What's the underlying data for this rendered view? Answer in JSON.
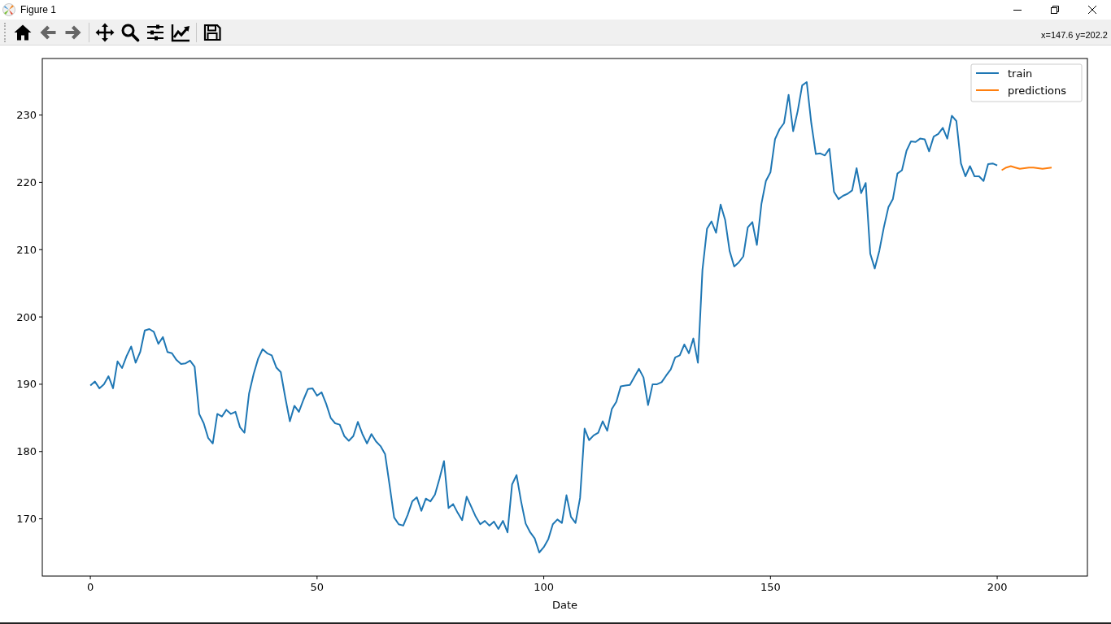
{
  "window": {
    "title": "Figure 1"
  },
  "toolbar": {
    "groups": [
      [
        {
          "kind": "home"
        },
        {
          "kind": "back"
        },
        {
          "kind": "forward"
        }
      ],
      [
        {
          "kind": "pan"
        },
        {
          "kind": "zoom"
        },
        {
          "kind": "configure"
        },
        {
          "kind": "edit"
        }
      ],
      [
        {
          "kind": "save"
        }
      ]
    ],
    "coordinates": "x=147.6 y=202.2"
  },
  "figure": {
    "chart_data": {
      "type": "line",
      "xlabel": "Date",
      "xlim": [
        -10.6,
        219.9
      ],
      "ylim": [
        161.5,
        238.4
      ],
      "xticks": [
        0,
        50,
        100,
        150,
        200
      ],
      "yticks": [
        170,
        180,
        190,
        200,
        210,
        220,
        230
      ],
      "x": [
        0,
        1,
        2,
        3,
        4,
        5,
        6,
        7,
        8,
        9,
        10,
        11,
        12,
        13,
        14,
        15,
        16,
        17,
        18,
        19,
        20,
        21,
        22,
        23,
        24,
        25,
        26,
        27,
        28,
        29,
        30,
        31,
        32,
        33,
        34,
        35,
        36,
        37,
        38,
        39,
        40,
        41,
        42,
        43,
        44,
        45,
        46,
        47,
        48,
        49,
        50,
        51,
        52,
        53,
        54,
        55,
        56,
        57,
        58,
        59,
        60,
        61,
        62,
        63,
        64,
        65,
        66,
        67,
        68,
        69,
        70,
        71,
        72,
        73,
        74,
        75,
        76,
        77,
        78,
        79,
        80,
        81,
        82,
        83,
        84,
        85,
        86,
        87,
        88,
        89,
        90,
        91,
        92,
        93,
        94,
        95,
        96,
        97,
        98,
        99,
        100,
        101,
        102,
        103,
        104,
        105,
        106,
        107,
        108,
        109,
        110,
        111,
        112,
        113,
        114,
        115,
        116,
        117,
        118,
        119,
        120,
        121,
        122,
        123,
        124,
        125,
        126,
        127,
        128,
        129,
        130,
        131,
        132,
        133,
        134,
        135,
        136,
        137,
        138,
        139,
        140,
        141,
        142,
        143,
        144,
        145,
        146,
        147,
        148,
        149,
        150,
        151,
        152,
        153,
        154,
        155,
        156,
        157,
        158,
        159,
        160,
        161,
        162,
        163,
        164,
        165,
        166,
        167,
        168,
        169,
        170,
        171,
        172,
        173,
        174,
        175,
        176,
        177,
        178,
        179,
        180,
        181,
        182,
        183,
        184,
        185,
        186,
        187,
        188,
        189,
        190,
        191,
        192,
        193,
        194,
        195,
        196,
        197,
        198,
        199,
        200,
        201,
        202,
        203,
        204,
        205,
        206,
        207,
        208,
        209,
        210,
        211,
        212
      ],
      "legend": true,
      "series": [
        {
          "name": "train",
          "color": "#1f77b4",
          "values": [
            189.8,
            190.4,
            189.4,
            190,
            191.2,
            189.4,
            193.4,
            192.4,
            194.2,
            195.6,
            193.2,
            194.8,
            198,
            198.2,
            197.8,
            196,
            197,
            194.8,
            194.6,
            193.6,
            193,
            193.1,
            193.5,
            192.6,
            185.6,
            184.2,
            182,
            181.2,
            185.6,
            185.2,
            186.2,
            185.6,
            185.9,
            183.6,
            182.8,
            188.6,
            191.5,
            193.8,
            195.2,
            194.6,
            194.3,
            192.5,
            191.8,
            188,
            184.5,
            186.8,
            185.9,
            187.7,
            189.3,
            189.4,
            188.3,
            188.8,
            187.1,
            185,
            184.2,
            184,
            182.3,
            181.6,
            182.3,
            184.4,
            182.6,
            181.2,
            182.6,
            181.5,
            180.8,
            179.6,
            175,
            170.2,
            169.2,
            169,
            170.6,
            172.6,
            173.2,
            171.2,
            173,
            172.6,
            173.6,
            176,
            178.6,
            171.6,
            172.2,
            170.9,
            169.8,
            173.3,
            171.8,
            170.3,
            169.2,
            169.7,
            169,
            169.6,
            168.5,
            169.7,
            168,
            175.1,
            176.5,
            172.6,
            169.3,
            168,
            167.1,
            165,
            165.8,
            167,
            169.2,
            169.9,
            169.4,
            173.5,
            170.3,
            169.4,
            173.1,
            183.4,
            181.7,
            182.4,
            182.8,
            184.5,
            183.1,
            186.3,
            187.4,
            189.7,
            189.8,
            189.9,
            191.1,
            192.3,
            191,
            186.9,
            190,
            190,
            190.3,
            191.3,
            192.2,
            194,
            194.3,
            195.9,
            194.6,
            196.8,
            193.2,
            207,
            213.1,
            214.2,
            212.5,
            216.7,
            214.4,
            209.8,
            207.5,
            208.1,
            209,
            213.3,
            214.1,
            210.7,
            216.8,
            220.2,
            221.5,
            226.4,
            227.9,
            228.8,
            233,
            227.6,
            230.6,
            234.4,
            234.9,
            228.8,
            224.2,
            224.3,
            224,
            225,
            218.6,
            217.5,
            218,
            218.3,
            218.8,
            222.1,
            218.4,
            219.9,
            209.4,
            207.2,
            209.8,
            213.3,
            216.3,
            217.5,
            221.3,
            221.8,
            224.7,
            226.1,
            226,
            226.5,
            226.4,
            224.6,
            226.8,
            227.2,
            228.1,
            226.5,
            229.9,
            229.1,
            222.8,
            220.9,
            222.4,
            220.9,
            220.9,
            220.2,
            222.7,
            222.8,
            222.5,
            null,
            null,
            null,
            null,
            null,
            null,
            null,
            null,
            null,
            null,
            null,
            null
          ]
        },
        {
          "name": "predictions",
          "color": "#ff7f0e",
          "values": [
            null,
            null,
            null,
            null,
            null,
            null,
            null,
            null,
            null,
            null,
            null,
            null,
            null,
            null,
            null,
            null,
            null,
            null,
            null,
            null,
            null,
            null,
            null,
            null,
            null,
            null,
            null,
            null,
            null,
            null,
            null,
            null,
            null,
            null,
            null,
            null,
            null,
            null,
            null,
            null,
            null,
            null,
            null,
            null,
            null,
            null,
            null,
            null,
            null,
            null,
            null,
            null,
            null,
            null,
            null,
            null,
            null,
            null,
            null,
            null,
            null,
            null,
            null,
            null,
            null,
            null,
            null,
            null,
            null,
            null,
            null,
            null,
            null,
            null,
            null,
            null,
            null,
            null,
            null,
            null,
            null,
            null,
            null,
            null,
            null,
            null,
            null,
            null,
            null,
            null,
            null,
            null,
            null,
            null,
            null,
            null,
            null,
            null,
            null,
            null,
            null,
            null,
            null,
            null,
            null,
            null,
            null,
            null,
            null,
            null,
            null,
            null,
            null,
            null,
            null,
            null,
            null,
            null,
            null,
            null,
            null,
            null,
            null,
            null,
            null,
            null,
            null,
            null,
            null,
            null,
            null,
            null,
            null,
            null,
            null,
            null,
            null,
            null,
            null,
            null,
            null,
            null,
            null,
            null,
            null,
            null,
            null,
            null,
            null,
            null,
            null,
            null,
            null,
            null,
            null,
            null,
            null,
            null,
            null,
            null,
            null,
            null,
            null,
            null,
            null,
            null,
            null,
            null,
            null,
            null,
            null,
            null,
            null,
            null,
            null,
            null,
            null,
            null,
            null,
            null,
            null,
            null,
            null,
            null,
            null,
            null,
            null,
            null,
            null,
            null,
            null,
            null,
            null,
            null,
            null,
            null,
            null,
            null,
            null,
            null,
            null,
            221.8,
            222.2,
            222.4,
            222.2,
            222,
            222.1,
            222.2,
            222.2,
            222.1,
            222,
            222.1,
            222.2
          ]
        }
      ]
    }
  }
}
